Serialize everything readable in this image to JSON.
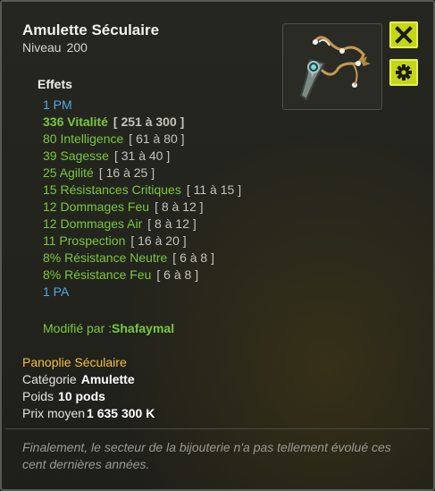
{
  "item": {
    "name": "Amulette Séculaire",
    "level_label": "Niveau",
    "level_value": "200",
    "image_icon": "amulet-icon"
  },
  "buttons": {
    "close_icon": "close-icon",
    "settings_icon": "gear-icon"
  },
  "effects": {
    "title": "Effets",
    "items": [
      {
        "text": "1 PM",
        "range": ""
      },
      {
        "text": "336 Vitalité",
        "range": "[ 251 à 300 ]"
      },
      {
        "text": "80 Intelligence",
        "range": "[ 61 à 80 ]"
      },
      {
        "text": "39 Sagesse",
        "range": "[ 31 à 40 ]"
      },
      {
        "text": "25 Agilité",
        "range": "[ 16 à 25 ]"
      },
      {
        "text": "15 Résistances Critiques",
        "range": "[ 11 à 15 ]"
      },
      {
        "text": "12 Dommages Feu",
        "range": "[ 8 à 12 ]"
      },
      {
        "text": "12 Dommages Air",
        "range": "[ 8 à 12 ]"
      },
      {
        "text": "11 Prospection",
        "range": "[ 16 à 20 ]"
      },
      {
        "text": "8% Résistance Neutre",
        "range": "[ 6 à 8 ]"
      },
      {
        "text": "8% Résistance Feu",
        "range": "[ 6 à 8 ]"
      },
      {
        "text": "1 PA",
        "range": ""
      }
    ],
    "modified_by_label": "Modifié par :",
    "modified_by_value": "Shafaymal"
  },
  "set": {
    "name": "Panoplie Séculaire"
  },
  "info": {
    "category_label": "Catégorie",
    "category_value": "Amulette",
    "weight_label": "Poids",
    "weight_value": "10 pods",
    "price_label": "Prix moyen",
    "price_value": "1 635 300 K"
  },
  "flavor_text": "Finalement, le secteur de la bijouterie n'a pas tellement évolué ces cent dernières années.",
  "colors": {
    "stat_green": "#78c83c",
    "ap_mp_blue": "#4fa8e8",
    "set_gold": "#f2c23a",
    "button_lime": "#c4d61a"
  }
}
